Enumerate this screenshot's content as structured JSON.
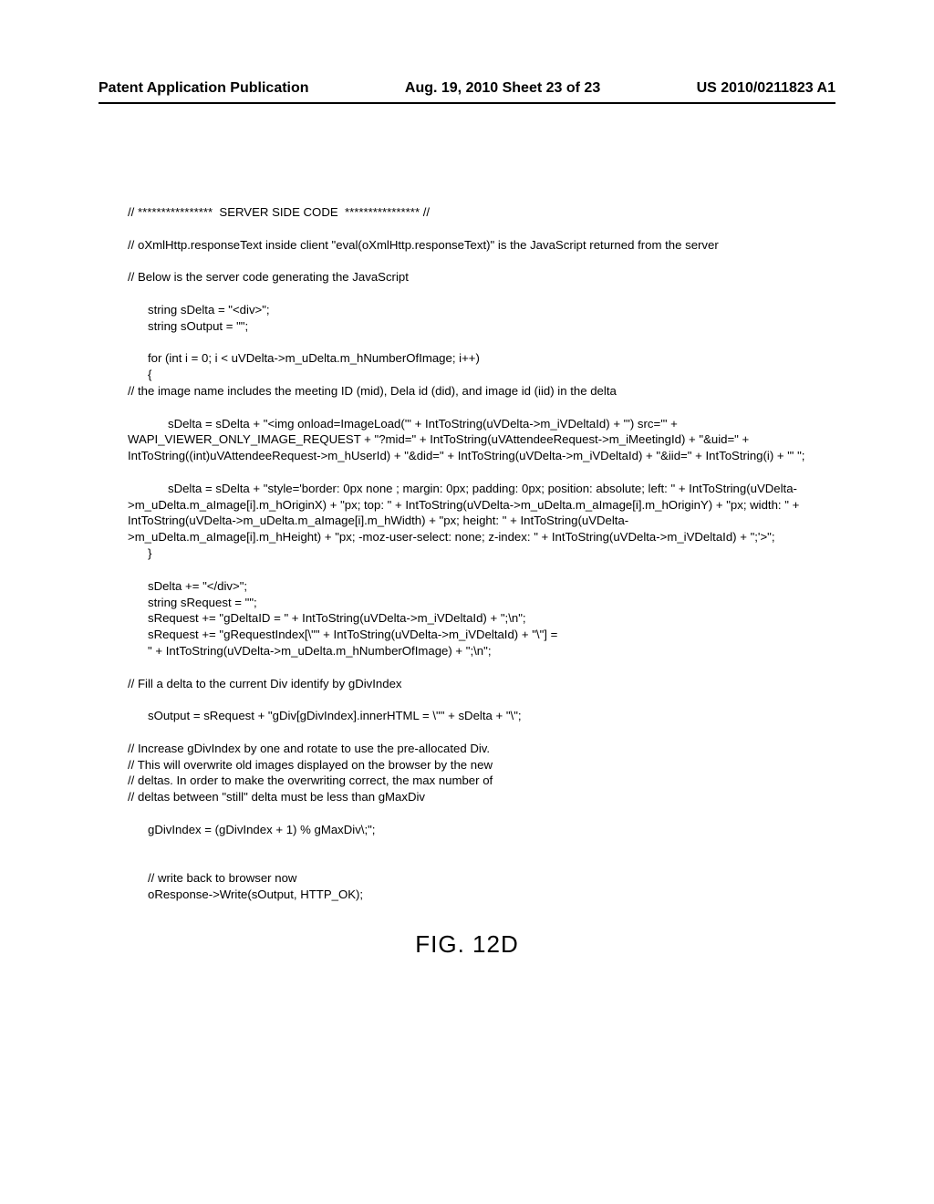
{
  "header": {
    "left": "Patent Application Publication",
    "center": "Aug. 19, 2010  Sheet 23 of 23",
    "right": "US 2010/0211823 A1"
  },
  "code": "// ****************  SERVER SIDE CODE  **************** //\n\n// oXmlHttp.responseText inside client \"eval(oXmlHttp.responseText)\" is the JavaScript returned from the server\n\n// Below is the server code generating the JavaScript\n\n      string sDelta = \"<div>\";\n      string sOutput = \"\";\n\n      for (int i = 0; i < uVDelta->m_uDelta.m_hNumberOfImage; i++)\n      {\n// the image name includes the meeting ID (mid), Dela id (did), and image id (iid) in the delta\n\n            sDelta = sDelta + \"<img onload=ImageLoad('\" + IntToString(uVDelta->m_iVDeltaId) + \"') src='\" + WAPI_VIEWER_ONLY_IMAGE_REQUEST + \"?mid=\" + IntToString(uVAttendeeRequest->m_iMeetingId) + \"&uid=\" + IntToString((int)uVAttendeeRequest->m_hUserId) + \"&did=\" + IntToString(uVDelta->m_iVDeltaId) + \"&iid=\" + IntToString(i) + \"' \";\n\n            sDelta = sDelta + \"style='border: 0px none ; margin: 0px; padding: 0px; position: absolute; left: \" + IntToString(uVDelta->m_uDelta.m_aImage[i].m_hOriginX) + \"px; top: \" + IntToString(uVDelta->m_uDelta.m_aImage[i].m_hOriginY) + \"px; width: \" + IntToString(uVDelta->m_uDelta.m_aImage[i].m_hWidth) + \"px; height: \" + IntToString(uVDelta->m_uDelta.m_aImage[i].m_hHeight) + \"px; -moz-user-select: none; z-index: \" + IntToString(uVDelta->m_iVDeltaId) + \";'>\";\n      }\n\n      sDelta += \"</div>\";\n      string sRequest = \"\";\n      sRequest += \"gDeltaID = \" + IntToString(uVDelta->m_iVDeltaId) + \";\\n\";\n      sRequest += \"gRequestIndex[\\\"\" + IntToString(uVDelta->m_iVDeltaId) + \"\\\"] =\n      \" + IntToString(uVDelta->m_uDelta.m_hNumberOfImage) + \";\\n\";\n\n// Fill a delta to the current Div identify by gDivIndex\n\n      sOutput = sRequest + \"gDiv[gDivIndex].innerHTML = \\\"\" + sDelta + \"\\\";\n\n// Increase gDivIndex by one and rotate to use the pre-allocated Div.\n// This will overwrite old images displayed on the browser by the new\n// deltas. In order to make the overwriting correct, the max number of\n// deltas between \"still\" delta must be less than gMaxDiv\n\n      gDivIndex = (gDivIndex + 1) % gMaxDiv\\;\";\n\n\n      // write back to browser now\n      oResponse->Write(sOutput, HTTP_OK);",
  "figure_label": "FIG. 12D"
}
